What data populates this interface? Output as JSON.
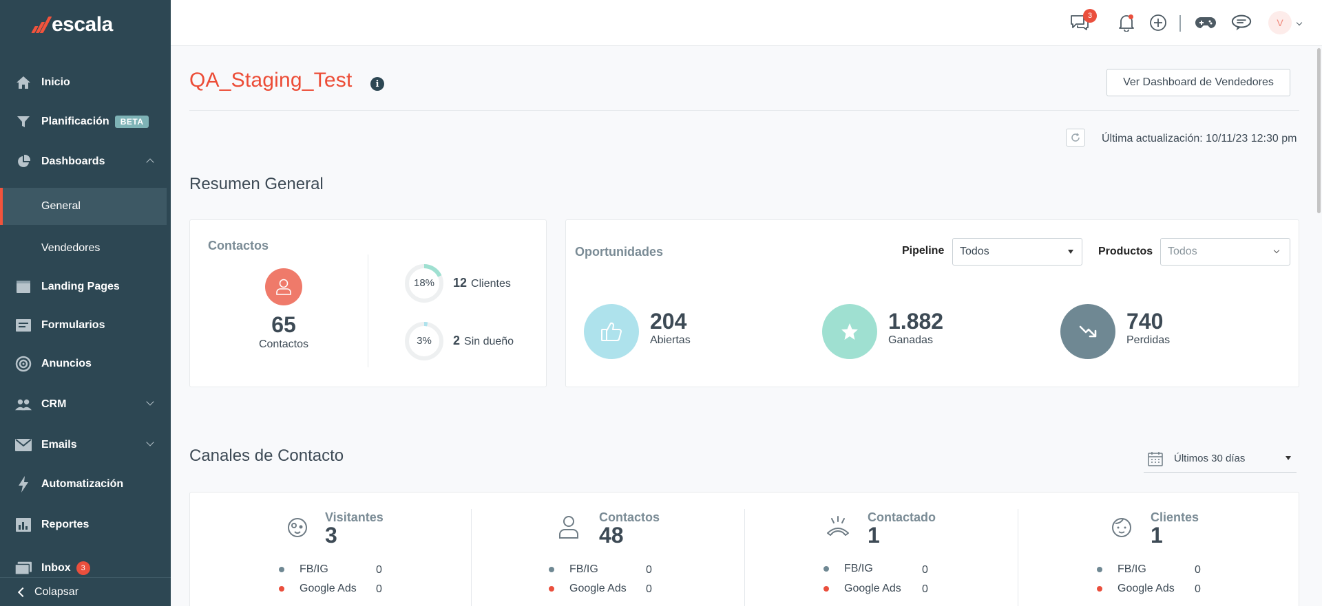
{
  "sidebar": {
    "logo": "escala",
    "beta_badge": "BETA",
    "inbox_badge": "3",
    "collapse_label": "Colapsar",
    "items": {
      "inicio": "Inicio",
      "planificacion": "Planificación",
      "dashboards": "Dashboards",
      "general": "General",
      "vendedores": "Vendedores",
      "landing_pages": "Landing Pages",
      "formularios": "Formularios",
      "anuncios": "Anuncios",
      "crm": "CRM",
      "emails": "Emails",
      "automatizacion": "Automatización",
      "reportes": "Reportes",
      "inbox": "Inbox"
    }
  },
  "topbar": {
    "chat_badge": "3",
    "avatar_initial": "V"
  },
  "header": {
    "title": "QA_Staging_Test",
    "dashboard_button": "Ver Dashboard de Vendedores",
    "last_update": "Última actualización: 10/11/23 12:30 pm"
  },
  "resumen": {
    "title": "Resumen General",
    "contactos": {
      "title": "Contactos",
      "total": "65",
      "total_label": "Contactos",
      "clientes_pct": "18%",
      "clientes_pct_value": 0.18,
      "clientes_count": "12",
      "clientes_label": "Clientes",
      "sin_dueno_pct": "3%",
      "sin_dueno_pct_value": 0.03,
      "sin_dueno_count": "2",
      "sin_dueno_label": "Sin dueño"
    },
    "oportunidades": {
      "title": "Oportunidades",
      "pipeline_label": "Pipeline",
      "pipeline_value": "Todos",
      "productos_label": "Productos",
      "productos_value": "Todos",
      "abiertas_num": "204",
      "abiertas_label": "Abiertas",
      "ganadas_num": "1.882",
      "ganadas_label": "Ganadas",
      "perdidas_num": "740",
      "perdidas_label": "Perdidas"
    }
  },
  "canales": {
    "title": "Canales de Contacto",
    "range": "Últimos 30 días",
    "columns": [
      {
        "title": "Visitantes",
        "count": "3",
        "rows": [
          {
            "label": "FB/IG",
            "value": "0"
          },
          {
            "label": "Google Ads",
            "value": "0"
          }
        ]
      },
      {
        "title": "Contactos",
        "count": "48",
        "rows": [
          {
            "label": "FB/IG",
            "value": "0"
          },
          {
            "label": "Google Ads",
            "value": "0"
          }
        ]
      },
      {
        "title": "Contactado",
        "count": "1",
        "rows": [
          {
            "label": "FB/IG",
            "value": "0"
          },
          {
            "label": "Google Ads",
            "value": "0"
          }
        ]
      },
      {
        "title": "Clientes",
        "count": "1",
        "rows": [
          {
            "label": "FB/IG",
            "value": "0"
          },
          {
            "label": "Google Ads",
            "value": "0"
          }
        ]
      }
    ]
  },
  "colors": {
    "sidebar_bg": "#2d4753",
    "accent": "#ec4c36",
    "abiertas": "#aee2ec",
    "ganadas": "#9fe0d1",
    "perdidas": "#6f8893",
    "fbig_dot": "#6f8893",
    "google_dot": "#ea4f3d"
  }
}
